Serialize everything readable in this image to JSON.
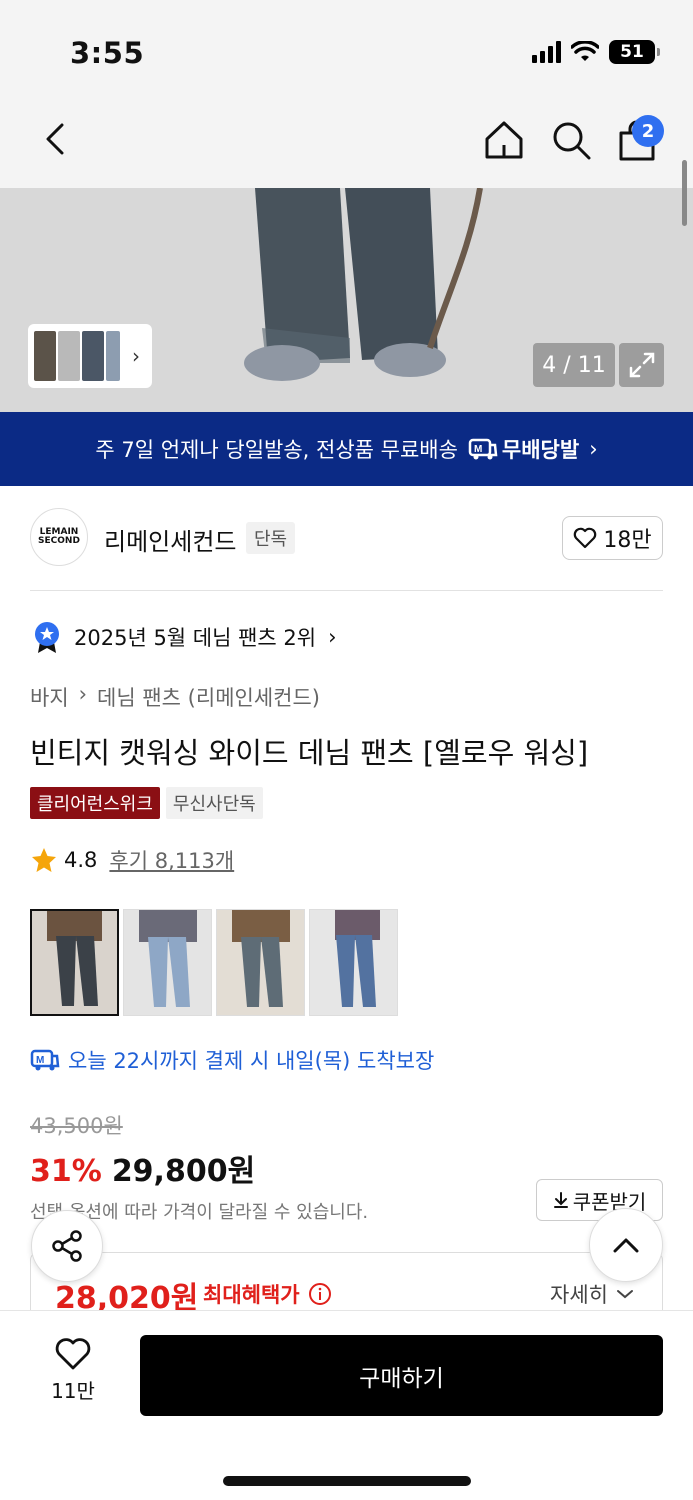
{
  "status": {
    "time": "3:55",
    "battery": "51"
  },
  "nav": {
    "cart_count": "2"
  },
  "gallery": {
    "counter": "4 / 11"
  },
  "banner": {
    "text": "주 7일 언제나 당일발송, 전상품 무료배송",
    "logo_text": "무배당발",
    "chevron": "›"
  },
  "brand": {
    "logo_text": "LEMAIN SECOND",
    "name": "리메인세컨드",
    "tag": "단독",
    "likes": "18만"
  },
  "ranking": {
    "text": "2025년 5월 데님 팬츠 2위",
    "chevron": "›"
  },
  "breadcrumb": {
    "category": "바지",
    "separator": "›",
    "subcategory": "데님 팬츠 (리메인세컨드)"
  },
  "product": {
    "title": "빈티지 캣워싱 와이드 데님 팬츠 [옐로우 워싱]",
    "tags": [
      "클리어런스위크",
      "무신사단독"
    ],
    "rating": "4.8",
    "reviews": "후기 8,113개"
  },
  "swatches": [
    {
      "color": "#3b4148"
    },
    {
      "color": "#8ea7c6"
    },
    {
      "color": "#5e6c76"
    },
    {
      "color": "#5372a0"
    }
  ],
  "delivery": {
    "text": "오늘 22시까지 결제 시 내일(목) 도착보장"
  },
  "price": {
    "original": "43,500원",
    "discount": "31%",
    "sale": "29,800원",
    "note": "선택 옵션에 따라 가격이 달라질 수 있습니다.",
    "coupon_label": "쿠폰받기"
  },
  "benefit": {
    "price": "28,020원",
    "label": "최대혜택가",
    "detail": "자세히"
  },
  "bottom": {
    "wish_count": "11만",
    "buy_label": "구매하기"
  },
  "colors": {
    "accent_red": "#e0201b",
    "banner_navy": "#0b2a85",
    "link_blue": "#1f5fd6",
    "badge_blue": "#2f6ff0"
  }
}
